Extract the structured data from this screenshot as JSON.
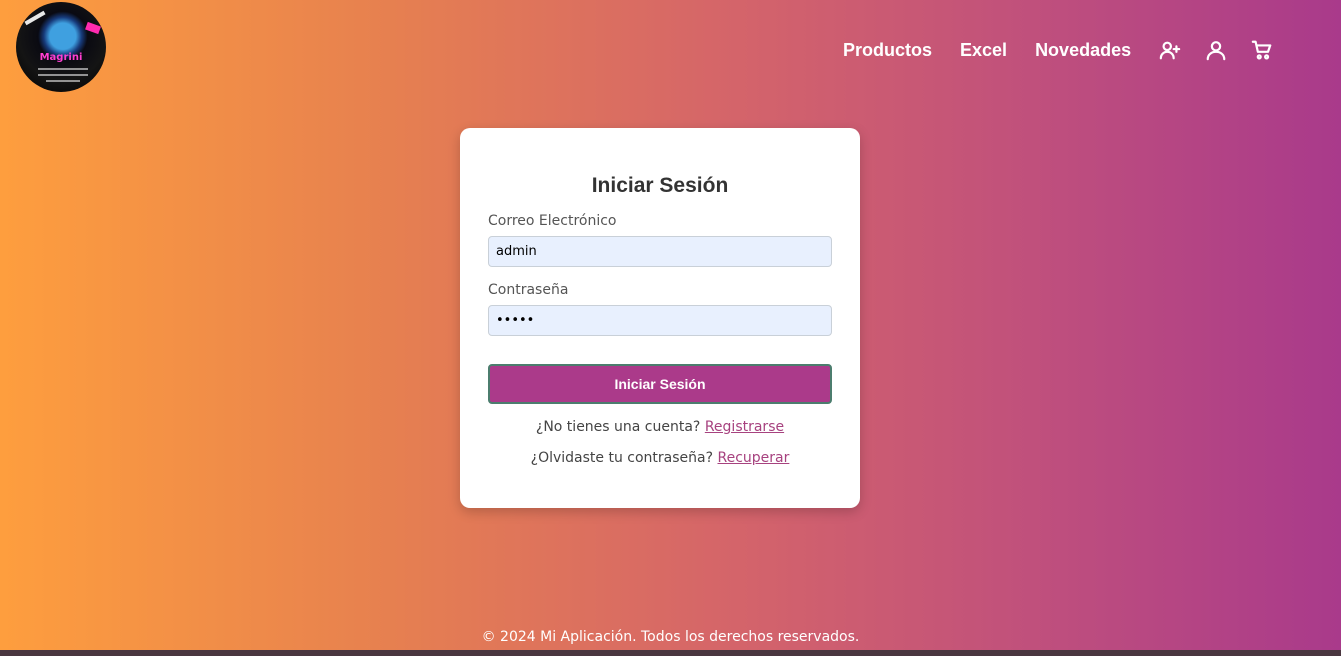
{
  "logo": {
    "brand": "Magrini"
  },
  "nav": {
    "links": [
      "Productos",
      "Excel",
      "Novedades"
    ],
    "icons": [
      "add-user-icon",
      "user-icon",
      "cart-icon"
    ]
  },
  "login": {
    "title": "Iniciar Sesión",
    "email_label": "Correo Electrónico",
    "email_value": "admin",
    "password_label": "Contraseña",
    "password_value": "admin",
    "submit_label": "Iniciar Sesión",
    "register_prompt": "¿No tienes una cuenta?",
    "register_link": "Registrarse",
    "recover_prompt": "¿Olvidaste tu contraseña?",
    "recover_link": "Recuperar"
  },
  "footer": {
    "text": "© 2024 Mi Aplicación. Todos los derechos reservados."
  },
  "colors": {
    "accent": "#ab3a8a",
    "gradient_start": "#fe9e3e",
    "gradient_end": "#a93a8b"
  }
}
